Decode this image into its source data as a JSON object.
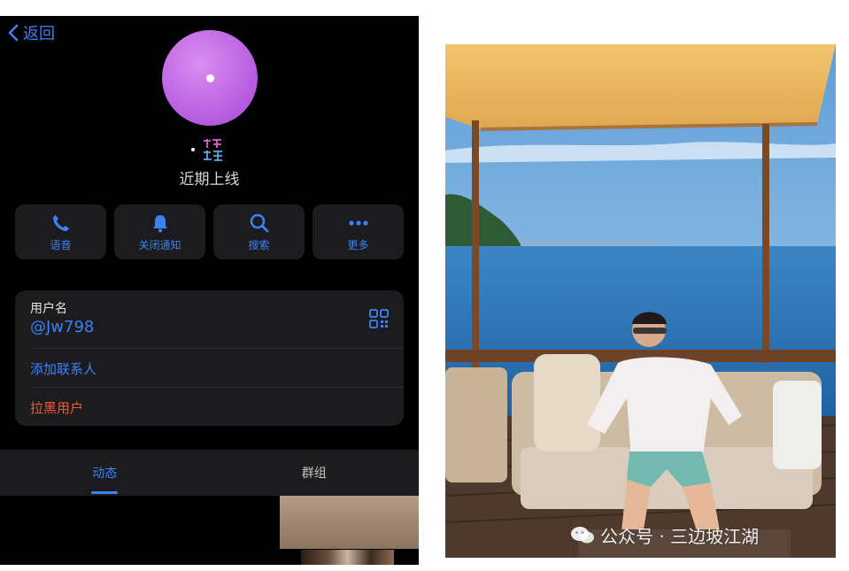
{
  "nav": {
    "back_label": "返回"
  },
  "profile": {
    "avatar_color": "#c16ee6",
    "badge_text": "招财进宝",
    "status": "近期上线"
  },
  "actions": [
    {
      "label": "语音",
      "icon": "phone-icon"
    },
    {
      "label": "关闭通知",
      "icon": "bell-icon"
    },
    {
      "label": "搜索",
      "icon": "search-icon"
    },
    {
      "label": "更多",
      "icon": "more-icon"
    }
  ],
  "info": {
    "username_label": "用户名",
    "username": "@Jw798",
    "add_contact": "添加联系人",
    "block_user": "拉黑用户"
  },
  "tabs": [
    {
      "label": "动态",
      "active": true
    },
    {
      "label": "群组",
      "active": false
    }
  ],
  "watermark": {
    "text": "公众号 · 三边坡江湖"
  },
  "colors": {
    "accent": "#3b82f6",
    "danger": "#ef5a3c",
    "surface": "#1c1c1e"
  }
}
